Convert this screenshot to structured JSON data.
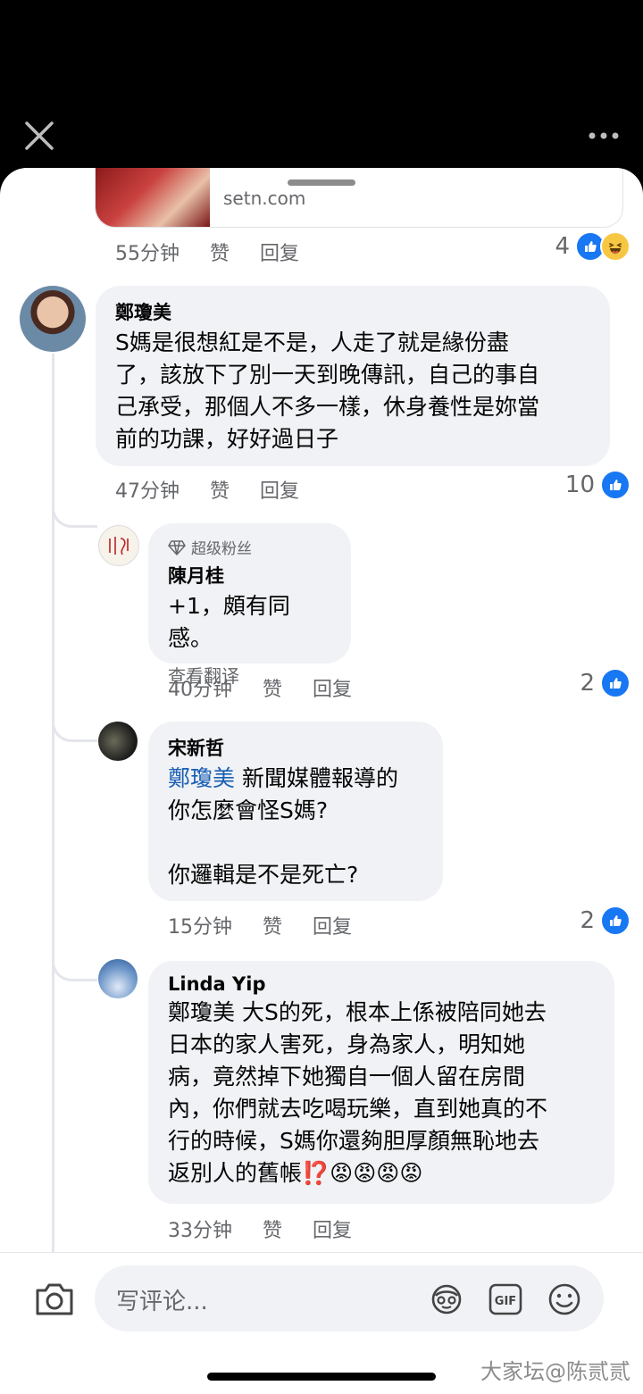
{
  "link_card": {
    "domain": "setn.com"
  },
  "top_comment_meta": {
    "time": "55分钟",
    "like": "赞",
    "reply": "回复",
    "reactions": "4"
  },
  "comments": [
    {
      "author": "鄭瓊美",
      "text": "S媽是很想紅是不是，人走了就是緣份盡\n了，該放下了別一天到晚傳訊，自己的事自\n己承受，那個人不多一樣，休身養性是妳當\n前的功課，好好過日子",
      "time": "47分钟",
      "like": "赞",
      "reply": "回复",
      "reactions": "10"
    },
    {
      "badge": "超级粉丝",
      "author": "陳月桂",
      "text": "+1，頗有同感。",
      "translate": "查看翻译",
      "time": "40分钟",
      "like": "赞",
      "reply": "回复",
      "reactions": "2"
    },
    {
      "author": "宋新哲",
      "mention": "鄭瓊美",
      "text_line1": " 新聞媒體報導的",
      "text_rest": "你怎麼會怪S媽?\n\n你邏輯是不是死亡?",
      "time": "15分钟",
      "like": "赞",
      "reply": "回复",
      "reactions": "2"
    },
    {
      "author": "Linda Yip",
      "text": "鄭瓊美 大S的死，根本上係被陪同她去\n日本的家人害死，身為家人，明知她\n病，竟然掉下她獨自一個人留在房間\n內，你們就去吃喝玩樂，直到她真的不\n行的時候，S媽你還夠胆厚顏無恥地去\n返別人的舊帳⁉️😡😡😡😡",
      "time": "33分钟",
      "like": "赞",
      "reply": "回复"
    }
  ],
  "composer": {
    "placeholder": "写评论..."
  },
  "watermark": "大家坛@陈贰贰",
  "colors": {
    "accent": "#1877f2",
    "bubble": "#f0f2f5",
    "meta": "#65676b"
  }
}
